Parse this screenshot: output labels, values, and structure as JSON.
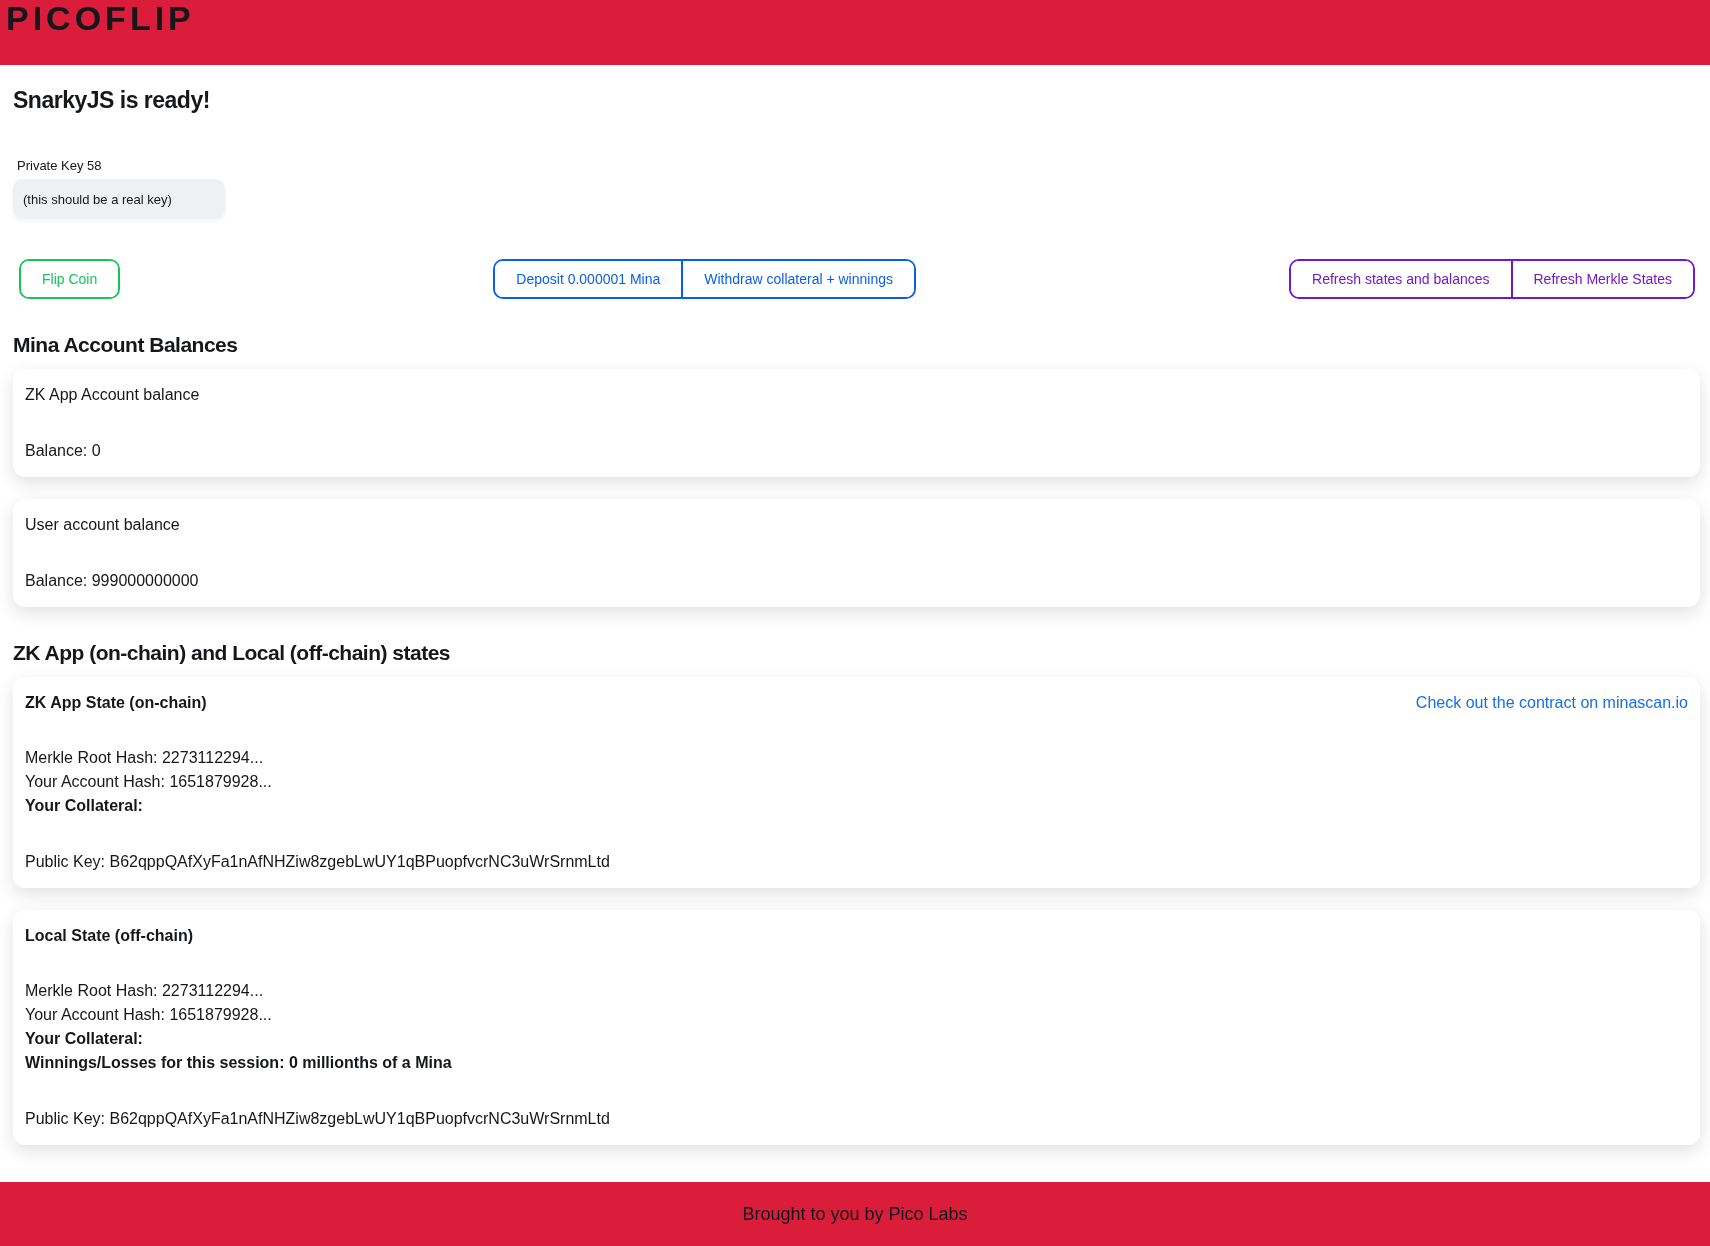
{
  "header": {
    "logo": "PICOFLIP"
  },
  "status_title": "SnarkyJS is ready!",
  "private_key": {
    "label": "Private Key 58",
    "value": "(this should be a real key)"
  },
  "button_groups": [
    {
      "color": "#16c45a",
      "buttons": [
        "Flip Coin"
      ]
    },
    {
      "color": "#0a5fe8",
      "buttons": [
        "Deposit 0.000001 Mina",
        "Withdraw collateral + winnings"
      ]
    },
    {
      "color": "#7417c9",
      "buttons": [
        "Refresh states and balances",
        "Refresh Merkle States"
      ]
    }
  ],
  "balances": {
    "heading": "Mina Account Balances",
    "cards": [
      {
        "title": "ZK App Account balance",
        "balance": "Balance: 0"
      },
      {
        "title": "User account balance",
        "balance": "Balance: 999000000000"
      }
    ]
  },
  "states": {
    "heading": "ZK App (on-chain) and Local (off-chain) states",
    "cards": [
      {
        "title": "ZK App State (on-chain)",
        "link": "Check out the contract on minascan.io",
        "lines": [
          {
            "text": "Merkle Root Hash: 2273112294...",
            "bold": false
          },
          {
            "text": "Your Account Hash: 1651879928...",
            "bold": false
          },
          {
            "text": "Your Collateral:",
            "bold": true
          }
        ],
        "public_key": "Public Key: B62qppQAfXyFa1nAfNHZiw8zgebLwUY1qBPuopfvcrNC3uWrSrnmLtd"
      },
      {
        "title": "Local State (off-chain)",
        "lines": [
          {
            "text": "Merkle Root Hash: 2273112294...",
            "bold": false
          },
          {
            "text": "Your Account Hash: 1651879928...",
            "bold": false
          },
          {
            "text": "Your Collateral:",
            "bold": true
          },
          {
            "text": "Winnings/Losses for this session: 0 millionths of a Mina",
            "bold": true
          }
        ],
        "public_key": "Public Key: B62qppQAfXyFa1nAfNHZiw8zgebLwUY1qBPuopfvcrNC3uWrSrnmLtd"
      }
    ]
  },
  "footer": {
    "text": "Brought to you by Pico Labs"
  }
}
